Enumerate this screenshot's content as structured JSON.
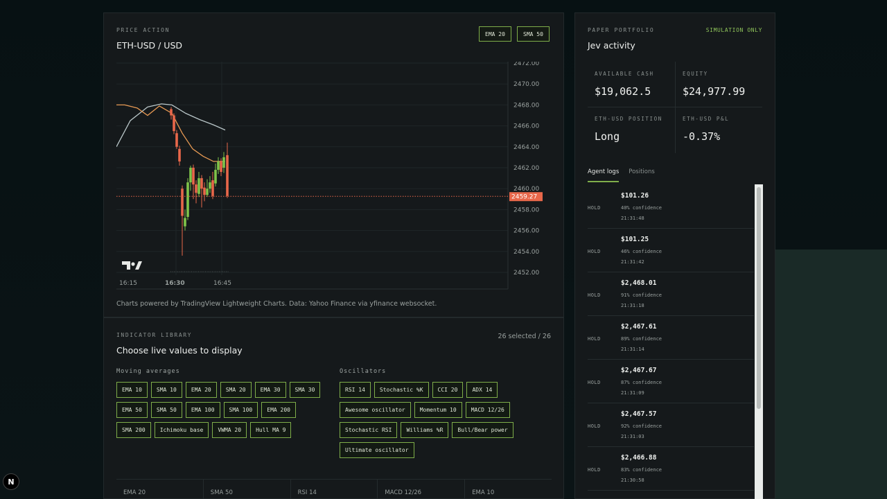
{
  "price": {
    "eyebrow": "PRICE ACTION",
    "title": "ETH-USD / USD",
    "toggles": [
      "EMA 20",
      "SMA 50"
    ],
    "caption": "Charts powered by TradingView Lightweight Charts. Data: Yahoo Finance via yfinance websocket.",
    "chart": {
      "y_ticks": [
        "2472.00",
        "2470.00",
        "2468.00",
        "2466.00",
        "2464.00",
        "2462.00",
        "2460.00",
        "2458.00",
        "2456.00",
        "2454.00",
        "2452.00"
      ],
      "x_ticks": [
        "16:15",
        "16:30",
        "16:45"
      ],
      "current_price": "2459.27",
      "up_color": "#7fc44a",
      "down_color": "#e8674a",
      "ema_color": "#e89a54",
      "sma_color": "#b9c6c8"
    }
  },
  "indicators": {
    "eyebrow": "INDICATOR LIBRARY",
    "title": "Choose live values to display",
    "count": "26 selected / 26",
    "moving_title": "Moving averages",
    "moving_rows": [
      [
        "EMA 10",
        "SMA 10",
        "EMA 20",
        "SMA 20",
        "EMA 30",
        "SMA 30"
      ],
      [
        "EMA 50",
        "SMA 50",
        "EMA 100",
        "SMA 100",
        "EMA 200"
      ],
      [
        "SMA 200",
        "Ichimoku base",
        "VWMA 20",
        "Hull MA 9"
      ]
    ],
    "osc_title": "Oscillators",
    "osc_rows": [
      [
        "RSI 14",
        "Stochastic %K",
        "CCI 20",
        "ADX 14"
      ],
      [
        "Awesome oscillator",
        "Momentum 10",
        "MACD 12/26"
      ],
      [
        "Stochastic RSI",
        "Williams %R",
        "Bull/Bear power"
      ],
      [
        "Ultimate oscillator"
      ]
    ],
    "live": [
      "EMA 20",
      "SMA 50",
      "RSI 14",
      "MACD 12/26",
      "EMA 10"
    ]
  },
  "portfolio": {
    "eyebrow": "PAPER PORTFOLIO",
    "badge": "SIMULATION ONLY",
    "title": "Jev activity",
    "cash_label": "AVAILABLE CASH",
    "cash_value": "$19,062.5",
    "equity_label": "EQUITY",
    "equity_value": "$24,977.99",
    "position_label": "ETH-USD POSITION",
    "position_value": "Long",
    "pnl_label": "ETH-USD P&L",
    "pnl_value": "-0.37%",
    "tabs": [
      "Agent logs",
      "Positions"
    ],
    "logs": [
      {
        "action": "HOLD",
        "price": "$101.26",
        "conf": "40% confidence",
        "time": "21:31:48"
      },
      {
        "action": "HOLD",
        "price": "$101.25",
        "conf": "46% confidence",
        "time": "21:31:42"
      },
      {
        "action": "HOLD",
        "price": "$2,468.01",
        "conf": "91% confidence",
        "time": "21:31:18"
      },
      {
        "action": "HOLD",
        "price": "$2,467.61",
        "conf": "89% confidence",
        "time": "21:31:14"
      },
      {
        "action": "HOLD",
        "price": "$2,467.67",
        "conf": "87% confidence",
        "time": "21:31:09"
      },
      {
        "action": "HOLD",
        "price": "$2,467.57",
        "conf": "92% confidence",
        "time": "21:31:03"
      },
      {
        "action": "HOLD",
        "price": "$2,466.88",
        "conf": "83% confidence",
        "time": "21:30:58"
      }
    ]
  },
  "dev_badge": "N"
}
